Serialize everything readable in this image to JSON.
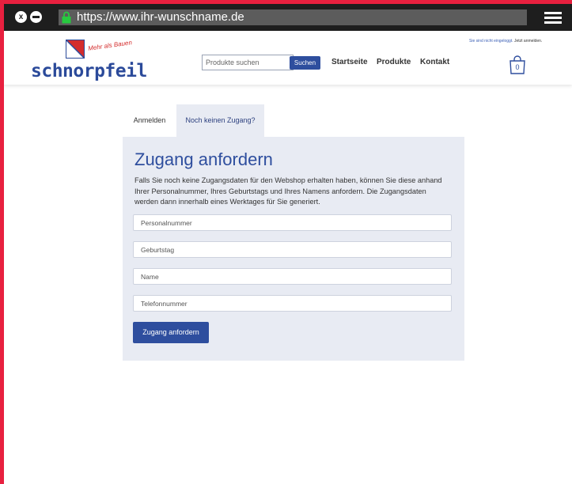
{
  "browser": {
    "url": "https://www.ihr-wunschname.de",
    "close_glyph": "x"
  },
  "header": {
    "logo_text": "schnorpfeil",
    "logo_tagline": "Mehr als Bauen",
    "search_placeholder": "Produkte suchen",
    "search_button": "Suchen",
    "nav": [
      "Startseite",
      "Produkte",
      "Kontakt"
    ],
    "login_note_prefix": "Sie sind nicht eingeloggt.",
    "login_note_link": "Jetzt anmelden.",
    "cart_count": "0"
  },
  "tabs": {
    "login": "Anmelden",
    "register": "Noch keinen Zugang?"
  },
  "form": {
    "title": "Zugang anfordern",
    "description": "Falls Sie noch keine Zugangsdaten für den Webshop erhalten haben, können Sie diese anhand Ihrer Personalnummer, Ihres Geburtstags und Ihres Namens anfordern. Die Zugangsdaten werden dann innerhalb eines Werktages für Sie generiert.",
    "fields": [
      "Personalnummer",
      "Geburtstag",
      "Name",
      "Telefonnummer"
    ],
    "submit": "Zugang anfordern"
  },
  "colors": {
    "frame_border": "#e8203f",
    "brand_blue": "#2e4e9e",
    "panel_bg": "#e8ebf3",
    "logo_red": "#d42c2c"
  },
  "icons": [
    "close-icon",
    "minimize-icon",
    "lock-icon",
    "menu-icon",
    "cart-bag-icon"
  ]
}
